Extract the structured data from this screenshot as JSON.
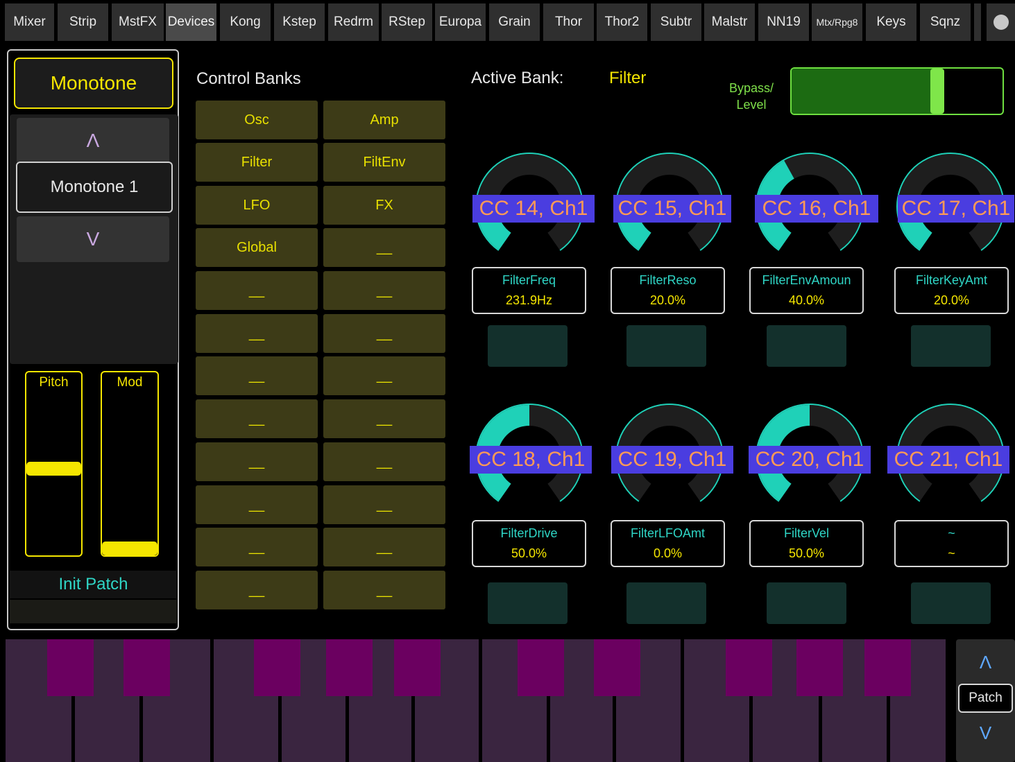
{
  "tabs": [
    {
      "label": "Mixer",
      "active": false
    },
    {
      "label": "Strip",
      "active": false
    },
    {
      "label": "MstFX",
      "active": false
    },
    {
      "label": "Devices",
      "active": true
    },
    {
      "label": "Kong",
      "active": false
    },
    {
      "label": "Kstep",
      "active": false
    },
    {
      "label": "Redrm",
      "active": false
    },
    {
      "label": "RStep",
      "active": false
    },
    {
      "label": "Europa",
      "active": false
    },
    {
      "label": "Grain",
      "active": false
    },
    {
      "label": "Thor",
      "active": false
    },
    {
      "label": "Thor2",
      "active": false
    },
    {
      "label": "Subtr",
      "active": false
    },
    {
      "label": "Malstr",
      "active": false
    },
    {
      "label": "NN19",
      "active": false
    },
    {
      "label": "Mtx/Rpg8",
      "active": false
    },
    {
      "label": "Keys",
      "active": false
    },
    {
      "label": "Sqnz",
      "active": false
    }
  ],
  "device": {
    "name": "Monotone",
    "patch_up": "Λ",
    "patch_name": "Monotone 1",
    "patch_down": "V",
    "pitch_label": "Pitch",
    "pitch_level": 0.55,
    "mod_label": "Mod",
    "mod_level": 0.0,
    "patch_title": "Init Patch"
  },
  "banks": {
    "title": "Control Banks",
    "left": [
      "Osc",
      "Filter",
      "LFO",
      "Global",
      "__",
      "__",
      "__",
      "__",
      "__",
      "__",
      "__",
      "__"
    ],
    "right": [
      "Amp",
      "FiltEnv",
      "FX",
      "__",
      "__",
      "__",
      "__",
      "__",
      "__",
      "__",
      "__",
      "__"
    ]
  },
  "active_bank": {
    "label": "Active Bank:",
    "value": "Filter",
    "bypass_label_1": "Bypass/",
    "bypass_label_2": "Level",
    "bypass_level": 0.69
  },
  "knobs": [
    {
      "cc": "CC 14, Ch1",
      "name": "FilterFreq",
      "value": "231.9Hz",
      "level": 0.18
    },
    {
      "cc": "CC 15, Ch1",
      "name": "FilterReso",
      "value": "20.0%",
      "level": 0.2
    },
    {
      "cc": "CC 16, Ch1",
      "name": "FilterEnvAmoun",
      "value": "40.0%",
      "level": 0.4
    },
    {
      "cc": "CC 17, Ch1",
      "name": "FilterKeyAmt",
      "value": "20.0%",
      "level": 0.2
    },
    {
      "cc": "CC 18, Ch1",
      "name": "FilterDrive",
      "value": "50.0%",
      "level": 0.5
    },
    {
      "cc": "CC 19, Ch1",
      "name": "FilterLFOAmt",
      "value": "0.0%",
      "level": 0.0
    },
    {
      "cc": "CC 20, Ch1",
      "name": "FilterVel",
      "value": "50.0%",
      "level": 0.5
    },
    {
      "cc": "CC 21, Ch1",
      "name": "~",
      "value": "~",
      "level": 0.0
    }
  ],
  "keyboard": {
    "octave_up": "Λ",
    "patch": "Patch",
    "octave_down": "V"
  },
  "colors": {
    "knob_fill": "#1fd1b8",
    "knob_track": "#1e1e1e",
    "accent_yellow": "#f5e600",
    "cc_label_bg": "#4a3de0",
    "cc_label_text": "#ff9a55"
  }
}
